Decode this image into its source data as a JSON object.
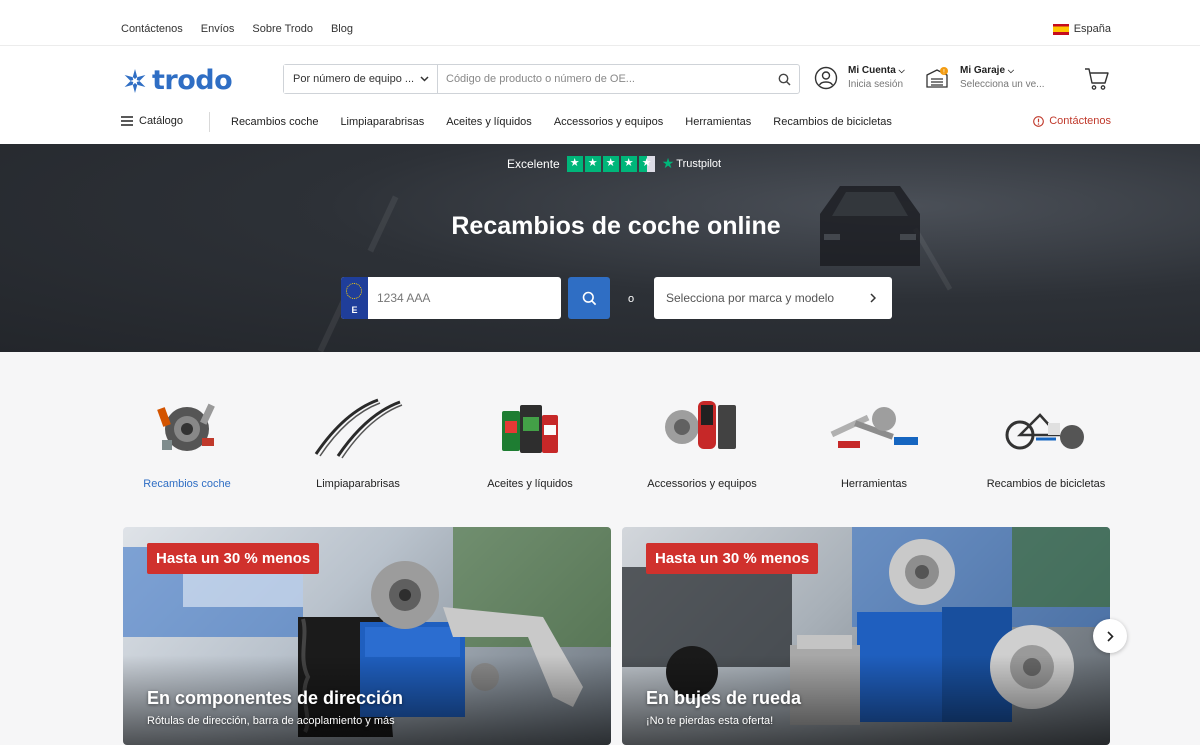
{
  "topbar": {
    "links": [
      "Contáctenos",
      "Envíos",
      "Sobre Trodo",
      "Blog"
    ],
    "country": "España"
  },
  "header": {
    "logo_text": "trodo",
    "search_select": "Por número de equipo ...",
    "search_placeholder": "Código de producto o número de OE...",
    "account_title": "Mi Cuenta",
    "account_sub": "Inicia sesión",
    "garage_title": "Mi Garaje",
    "garage_sub": "Selecciona un ve..."
  },
  "nav": {
    "catalog": "Catálogo",
    "items": [
      "Recambios coche",
      "Limpiaparabrisas",
      "Aceites y líquidos",
      "Accessorios y equipos",
      "Herramientas",
      "Recambios de bicicletas"
    ],
    "contact": "Contáctenos"
  },
  "hero": {
    "rating_label": "Excelente",
    "trustpilot": "Trustpilot",
    "stars": 4.5,
    "title": "Recambios de coche online",
    "plate_letter": "E",
    "plate_placeholder": "1234 AAA",
    "or": "o",
    "brand_select": "Selecciona por marca y modelo"
  },
  "categories": [
    {
      "label": "Recambios coche",
      "active": true
    },
    {
      "label": "Limpiaparabrisas",
      "active": false
    },
    {
      "label": "Aceites y líquidos",
      "active": false
    },
    {
      "label": "Accessorios y equipos",
      "active": false
    },
    {
      "label": "Herramientas",
      "active": false
    },
    {
      "label": "Recambios de bicicletas",
      "active": false
    }
  ],
  "promos": [
    {
      "badge": "Hasta un 30 % menos",
      "title": "En componentes de dirección",
      "subtitle": "Rótulas de dirección, barra de acoplamiento y más"
    },
    {
      "badge": "Hasta un 30 % menos",
      "title": "En bujes de rueda",
      "subtitle": "¡No te pierdas esta oferta!"
    }
  ],
  "colors": {
    "brand": "#2f6ec4",
    "accent_red": "#d0312d",
    "trustpilot_green": "#00b67a"
  }
}
